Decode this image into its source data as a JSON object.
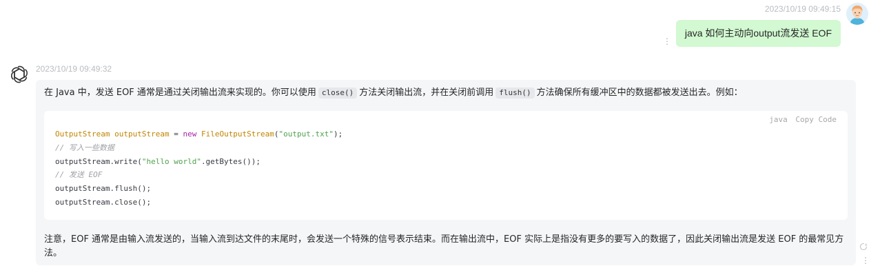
{
  "user_message": {
    "timestamp": "2023/10/19 09:49:15",
    "text": "java 如何主动向output流发送 EOF",
    "more_glyph": "⋮"
  },
  "assistant_message": {
    "timestamp": "2023/10/19 09:49:32",
    "intro": {
      "part1": "在 Java 中，发送 EOF 通常是通过关闭输出流来实现的。你可以使用",
      "code1": "close()",
      "part2": "方法关闭输出流，并在关闭前调用",
      "code2": "flush()",
      "part3": "方法确保所有缓冲区中的数据都被发送出去。例如："
    },
    "code_block": {
      "language": "java",
      "copy_label": "Copy Code",
      "lines": [
        {
          "tokens": [
            {
              "t": "type",
              "v": "OutputStream outputStream"
            },
            {
              "t": "plain",
              "v": " = "
            },
            {
              "t": "kw",
              "v": "new"
            },
            {
              "t": "plain",
              "v": " "
            },
            {
              "t": "type",
              "v": "FileOutputStream"
            },
            {
              "t": "plain",
              "v": "("
            },
            {
              "t": "str",
              "v": "\"output.txt\""
            },
            {
              "t": "plain",
              "v": ");"
            }
          ]
        },
        {
          "tokens": [
            {
              "t": "cm",
              "v": "// 写入一些数据"
            }
          ]
        },
        {
          "tokens": [
            {
              "t": "plain",
              "v": "outputStream.write("
            },
            {
              "t": "str",
              "v": "\"hello world\""
            },
            {
              "t": "plain",
              "v": ".getBytes());"
            }
          ]
        },
        {
          "tokens": [
            {
              "t": "cm",
              "v": "// 发送 EOF"
            }
          ]
        },
        {
          "tokens": [
            {
              "t": "plain",
              "v": "outputStream.flush();"
            }
          ]
        },
        {
          "tokens": [
            {
              "t": "plain",
              "v": "outputStream.close();"
            }
          ]
        }
      ]
    },
    "outro": "注意，EOF 通常是由输入流发送的，当输入流到达文件的末尾时，会发送一个特殊的信号表示结束。而在输出流中，EOF 实际上是指没有更多的要写入的数据了，因此关闭输出流是发送 EOF 的最常见方法。",
    "more_glyph": "⋮"
  },
  "icons": {
    "user_avatar": "user-avatar-icon",
    "bot_avatar": "openai-logo-icon",
    "regenerate": "refresh-icon"
  },
  "colors": {
    "user_bubble": "#d2f9d1",
    "assistant_bubble": "#f4f6f8",
    "code_bg": "#ffffff"
  }
}
